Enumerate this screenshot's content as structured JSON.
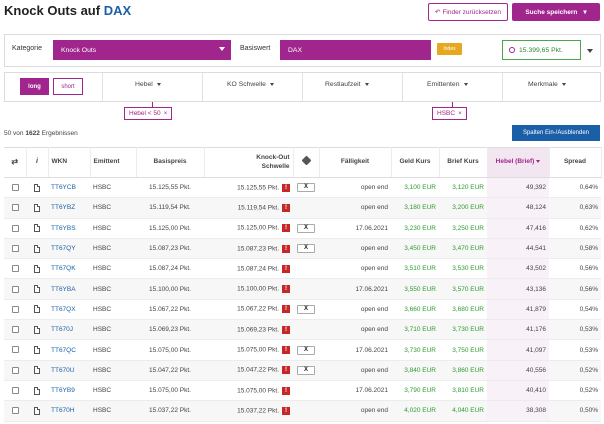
{
  "header": {
    "title_prefix": "Knock Outs auf",
    "title_accent": "DAX"
  },
  "buttons": {
    "reset": "Finder zurücksetzen",
    "reset_icon": "↶",
    "save": "Suche speichern",
    "save_icon": "▾",
    "columns": "Spalten Ein-/Ausblenden"
  },
  "filters": {
    "kategorie_label": "Kategorie",
    "kategorie_value": "Knock Outs",
    "basiswert_label": "Basiswert",
    "basiswert_value": "DAX",
    "index_badge": "Index",
    "price": "15.399,65 Pkt."
  },
  "tabs": {
    "long": "long",
    "short": "short",
    "items": [
      "Hebel",
      "KO Schwelle",
      "Restlaufzeit",
      "Emittenten",
      "Merkmale"
    ]
  },
  "chips": [
    {
      "label": "Hebel < 50",
      "close": "×"
    },
    {
      "label": "HSBC",
      "close": "×"
    }
  ],
  "results": {
    "prefix": "50 von",
    "count": "1622",
    "suffix": "Ergebnissen"
  },
  "table": {
    "headers": {
      "info": "i",
      "wkn": "WKN",
      "emittent": "Emittent",
      "basispreis": "Basispreis",
      "ko1": "Knock-Out",
      "ko2": "Schwelle",
      "faelligkeit": "Fälligkeit",
      "geld": "Geld Kurs",
      "brief": "Brief Kurs",
      "hebel": "Hebel (Brief)",
      "spread": "Spread"
    },
    "warn_symbol": "!",
    "x_symbol": "X",
    "rows": [
      {
        "wkn": "TT6YCB",
        "emittent": "HSBC",
        "basispreis": "15.125,55 Pkt.",
        "ko": "15.125,55 Pkt.",
        "has_x": true,
        "faelligkeit": "open end",
        "geld": "3,100 EUR",
        "brief": "3,120 EUR",
        "hebel": "49,392",
        "spread": "0,64%"
      },
      {
        "wkn": "TT6YBZ",
        "emittent": "HSBC",
        "basispreis": "15.119,54 Pkt.",
        "ko": "15.119,54 Pkt.",
        "has_x": false,
        "faelligkeit": "open end",
        "geld": "3,180 EUR",
        "brief": "3,200 EUR",
        "hebel": "48,124",
        "spread": "0,63%"
      },
      {
        "wkn": "TT6YBS",
        "emittent": "HSBC",
        "basispreis": "15.125,00 Pkt.",
        "ko": "15.125,00 Pkt.",
        "has_x": true,
        "faelligkeit": "17.06.2021",
        "geld": "3,230 EUR",
        "brief": "3,250 EUR",
        "hebel": "47,416",
        "spread": "0,62%"
      },
      {
        "wkn": "TT67QY",
        "emittent": "HSBC",
        "basispreis": "15.087,23 Pkt.",
        "ko": "15.087,23 Pkt.",
        "has_x": true,
        "faelligkeit": "open end",
        "geld": "3,450 EUR",
        "brief": "3,470 EUR",
        "hebel": "44,541",
        "spread": "0,58%"
      },
      {
        "wkn": "TT67QK",
        "emittent": "HSBC",
        "basispreis": "15.087,24 Pkt.",
        "ko": "15.087,24 Pkt.",
        "has_x": false,
        "faelligkeit": "open end",
        "geld": "3,510 EUR",
        "brief": "3,530 EUR",
        "hebel": "43,502",
        "spread": "0,56%"
      },
      {
        "wkn": "TT6YBA",
        "emittent": "HSBC",
        "basispreis": "15.100,00 Pkt.",
        "ko": "15.100,00 Pkt.",
        "has_x": false,
        "faelligkeit": "17.06.2021",
        "geld": "3,550 EUR",
        "brief": "3,570 EUR",
        "hebel": "43,136",
        "spread": "0,56%"
      },
      {
        "wkn": "TT67QX",
        "emittent": "HSBC",
        "basispreis": "15.067,22 Pkt.",
        "ko": "15.067,22 Pkt.",
        "has_x": true,
        "faelligkeit": "open end",
        "geld": "3,660 EUR",
        "brief": "3,680 EUR",
        "hebel": "41,879",
        "spread": "0,54%"
      },
      {
        "wkn": "TT670J",
        "emittent": "HSBC",
        "basispreis": "15.069,23 Pkt.",
        "ko": "15.069,23 Pkt.",
        "has_x": false,
        "faelligkeit": "open end",
        "geld": "3,710 EUR",
        "brief": "3,730 EUR",
        "hebel": "41,176",
        "spread": "0,53%"
      },
      {
        "wkn": "TT67QC",
        "emittent": "HSBC",
        "basispreis": "15.075,00 Pkt.",
        "ko": "15.075,00 Pkt.",
        "has_x": true,
        "faelligkeit": "17.06.2021",
        "geld": "3,730 EUR",
        "brief": "3,750 EUR",
        "hebel": "41,097",
        "spread": "0,53%"
      },
      {
        "wkn": "TT670U",
        "emittent": "HSBC",
        "basispreis": "15.047,22 Pkt.",
        "ko": "15.047,22 Pkt.",
        "has_x": true,
        "faelligkeit": "open end",
        "geld": "3,840 EUR",
        "brief": "3,860 EUR",
        "hebel": "40,556",
        "spread": "0,52%"
      },
      {
        "wkn": "TT6YB9",
        "emittent": "HSBC",
        "basispreis": "15.075,00 Pkt.",
        "ko": "15.075,00 Pkt.",
        "has_x": false,
        "faelligkeit": "17.06.2021",
        "geld": "3,790 EUR",
        "brief": "3,810 EUR",
        "hebel": "40,410",
        "spread": "0,52%"
      },
      {
        "wkn": "TT670H",
        "emittent": "HSBC",
        "basispreis": "15.037,22 Pkt.",
        "ko": "15.037,22 Pkt.",
        "has_x": false,
        "faelligkeit": "open end",
        "geld": "4,020 EUR",
        "brief": "4,040 EUR",
        "hebel": "38,308",
        "spread": "0,50%"
      }
    ]
  },
  "colors": {
    "accent": "#a0268e",
    "brand_blue": "#1b5fa8",
    "price_green": "#2e9a2e",
    "index_orange": "#e6a81e",
    "warning_red": "#c62828"
  }
}
